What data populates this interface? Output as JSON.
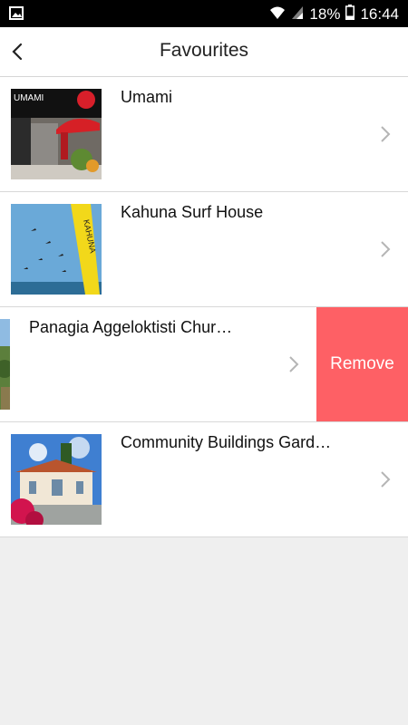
{
  "status_bar": {
    "battery_text": "18%",
    "time": "16:44",
    "icons": [
      "image-icon",
      "wifi-icon",
      "signal-icon",
      "battery-icon"
    ]
  },
  "header": {
    "title": "Favourites",
    "back_icon": "chevron-left-icon"
  },
  "favourites": [
    {
      "name": "Umami",
      "swiped": false
    },
    {
      "name": "Kahuna Surf House",
      "swiped": false
    },
    {
      "name": "Panagia Aggeloktisti Chur…",
      "swiped": true,
      "remove_label": "Remove"
    },
    {
      "name": "Community Buildings Gard…",
      "swiped": false
    }
  ],
  "thumb_text": {
    "umami_sign": "UMAMI",
    "kahuna_banner": "KAHUNA"
  },
  "colors": {
    "remove": "#fe6065",
    "background": "#efefef"
  }
}
